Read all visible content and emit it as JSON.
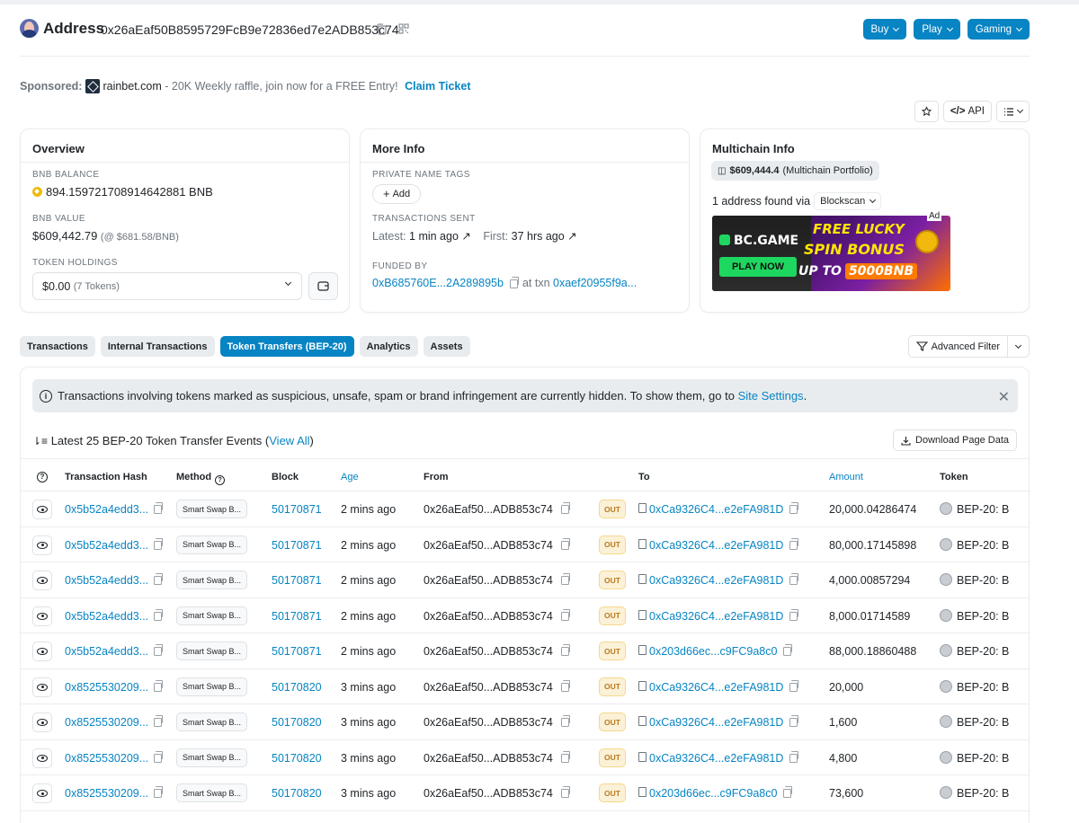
{
  "header": {
    "title": "Address",
    "address": "0x26aEaf50B8595729FcB9e72836ed7e2ADB853c74",
    "buttons": [
      "Buy",
      "Play",
      "Gaming"
    ]
  },
  "sponsored": {
    "label": "Sponsored:",
    "brand": "rainbet.com",
    "text": " - 20K Weekly raffle, join now for a FREE Entry! ",
    "link": "Claim Ticket"
  },
  "tools": {
    "api": "API"
  },
  "overview": {
    "title": "Overview",
    "balance_label": "BNB BALANCE",
    "balance": "894.159721708914642881 BNB",
    "value_label": "BNB VALUE",
    "value": "$609,442.79",
    "value_rate": "(@ $681.58/BNB)",
    "holdings_label": "TOKEN HOLDINGS",
    "holdings_value": "$0.00",
    "holdings_count": "(7 Tokens)"
  },
  "more_info": {
    "title": "More Info",
    "tags_label": "PRIVATE NAME TAGS",
    "add": "Add",
    "sent_label": "TRANSACTIONS SENT",
    "latest_label": "Latest:",
    "latest": "1 min ago",
    "first_label": "First:",
    "first": "37 hrs ago",
    "funded_label": "FUNDED BY",
    "funded_by": "0xB685760E...2A289895b",
    "at_txn": "at txn",
    "txn": "0xaef20955f9a..."
  },
  "multichain": {
    "title": "Multichain Info",
    "portfolio_value": "$609,444.4",
    "portfolio_label": "(Multichain Portfolio)",
    "found_text": "1 address found via",
    "source": "Blockscan",
    "ad_label": "Ad",
    "ad_brand": "BC.GAME",
    "ad_play": "PLAY NOW",
    "ad_line1": "FREE LUCKY",
    "ad_line2": "SPIN BONUS",
    "ad_line3a": "UP TO",
    "ad_line3b": "5000BNB"
  },
  "tabs": [
    "Transactions",
    "Internal Transactions",
    "Token Transfers (BEP-20)",
    "Analytics",
    "Assets"
  ],
  "advanced_filter": "Advanced Filter",
  "alert": {
    "text": "Transactions involving tokens marked as suspicious, unsafe, spam or brand infringement are currently hidden. To show them, go to ",
    "link": "Site Settings",
    "end": "."
  },
  "latest": {
    "text": "Latest 25 BEP-20 Token Transfer Events (",
    "link": "View All",
    "end": ")"
  },
  "download": "Download Page Data",
  "columns": {
    "hash": "Transaction Hash",
    "method": "Method",
    "block": "Block",
    "age": "Age",
    "from": "From",
    "to": "To",
    "amount": "Amount",
    "token": "Token"
  },
  "rows": [
    {
      "hash": "0x5b52a4edd3...",
      "method": "Smart Swap B...",
      "block": "50170871",
      "age": "2 mins ago",
      "from": "0x26aEaf50...ADB853c74",
      "dir": "OUT",
      "to": "0xCa9326C4...e2eFA981D",
      "amount": "20,000.04286474",
      "token": "BEP-20: B"
    },
    {
      "hash": "0x5b52a4edd3...",
      "method": "Smart Swap B...",
      "block": "50170871",
      "age": "2 mins ago",
      "from": "0x26aEaf50...ADB853c74",
      "dir": "OUT",
      "to": "0xCa9326C4...e2eFA981D",
      "amount": "80,000.17145898",
      "token": "BEP-20: B"
    },
    {
      "hash": "0x5b52a4edd3...",
      "method": "Smart Swap B...",
      "block": "50170871",
      "age": "2 mins ago",
      "from": "0x26aEaf50...ADB853c74",
      "dir": "OUT",
      "to": "0xCa9326C4...e2eFA981D",
      "amount": "4,000.00857294",
      "token": "BEP-20: B"
    },
    {
      "hash": "0x5b52a4edd3...",
      "method": "Smart Swap B...",
      "block": "50170871",
      "age": "2 mins ago",
      "from": "0x26aEaf50...ADB853c74",
      "dir": "OUT",
      "to": "0xCa9326C4...e2eFA981D",
      "amount": "8,000.01714589",
      "token": "BEP-20: B"
    },
    {
      "hash": "0x5b52a4edd3...",
      "method": "Smart Swap B...",
      "block": "50170871",
      "age": "2 mins ago",
      "from": "0x26aEaf50...ADB853c74",
      "dir": "OUT",
      "to": "0x203d66ec...c9FC9a8c0",
      "amount": "88,000.18860488",
      "token": "BEP-20: B"
    },
    {
      "hash": "0x8525530209...",
      "method": "Smart Swap B...",
      "block": "50170820",
      "age": "3 mins ago",
      "from": "0x26aEaf50...ADB853c74",
      "dir": "OUT",
      "to": "0xCa9326C4...e2eFA981D",
      "amount": "20,000",
      "token": "BEP-20: B"
    },
    {
      "hash": "0x8525530209...",
      "method": "Smart Swap B...",
      "block": "50170820",
      "age": "3 mins ago",
      "from": "0x26aEaf50...ADB853c74",
      "dir": "OUT",
      "to": "0xCa9326C4...e2eFA981D",
      "amount": "1,600",
      "token": "BEP-20: B"
    },
    {
      "hash": "0x8525530209...",
      "method": "Smart Swap B...",
      "block": "50170820",
      "age": "3 mins ago",
      "from": "0x26aEaf50...ADB853c74",
      "dir": "OUT",
      "to": "0xCa9326C4...e2eFA981D",
      "amount": "4,800",
      "token": "BEP-20: B"
    },
    {
      "hash": "0x8525530209...",
      "method": "Smart Swap B...",
      "block": "50170820",
      "age": "3 mins ago",
      "from": "0x26aEaf50...ADB853c74",
      "dir": "OUT",
      "to": "0x203d66ec...c9FC9a8c0",
      "amount": "73,600",
      "token": "BEP-20: B"
    }
  ]
}
